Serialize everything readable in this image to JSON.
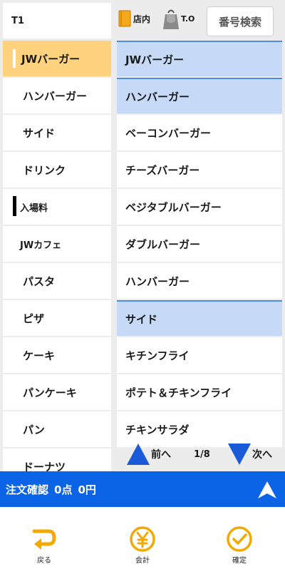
{
  "header": {
    "table": "T1",
    "eat_in": "店内",
    "take_out": "T.O",
    "search": "番号検索"
  },
  "categories": [
    {
      "label": "JWバーガー",
      "active": true
    },
    {
      "label": "ハンバーガー"
    },
    {
      "label": "サイド"
    },
    {
      "label": "ドリンク"
    },
    {
      "label": "入場料",
      "marked": true
    },
    {
      "label": "JWカフェ"
    },
    {
      "label": "パスタ"
    },
    {
      "label": "ピザ"
    },
    {
      "label": "ケーキ"
    },
    {
      "label": "パンケーキ"
    },
    {
      "label": "パン"
    },
    {
      "label": "ドーナツ"
    }
  ],
  "menu": [
    {
      "label": "JWバーガー",
      "section": true
    },
    {
      "label": "ハンバーガー",
      "section": true
    },
    {
      "label": "ベーコンバーガー"
    },
    {
      "label": "チーズバーガー"
    },
    {
      "label": "ベジタブルバーガー"
    },
    {
      "label": "ダブルバーガー"
    },
    {
      "label": "ハンバーガー"
    },
    {
      "label": "サイド",
      "section": true
    },
    {
      "label": "キチンフライ"
    },
    {
      "label": "ポテト＆チキンフライ"
    },
    {
      "label": "チキンサラダ"
    }
  ],
  "pager": {
    "prev": "前へ",
    "page": "1/8",
    "next": "次へ"
  },
  "order": {
    "label": "注文確認",
    "count": "0点",
    "total": "0円"
  },
  "footer": {
    "back": "戻る",
    "checkout": "会計",
    "confirm": "確定"
  },
  "colors": {
    "accent_blue": "#0b63e5",
    "active_category": "#ffd27d",
    "section_bg": "#c6daf7",
    "footer_icon": "#f2a900"
  }
}
